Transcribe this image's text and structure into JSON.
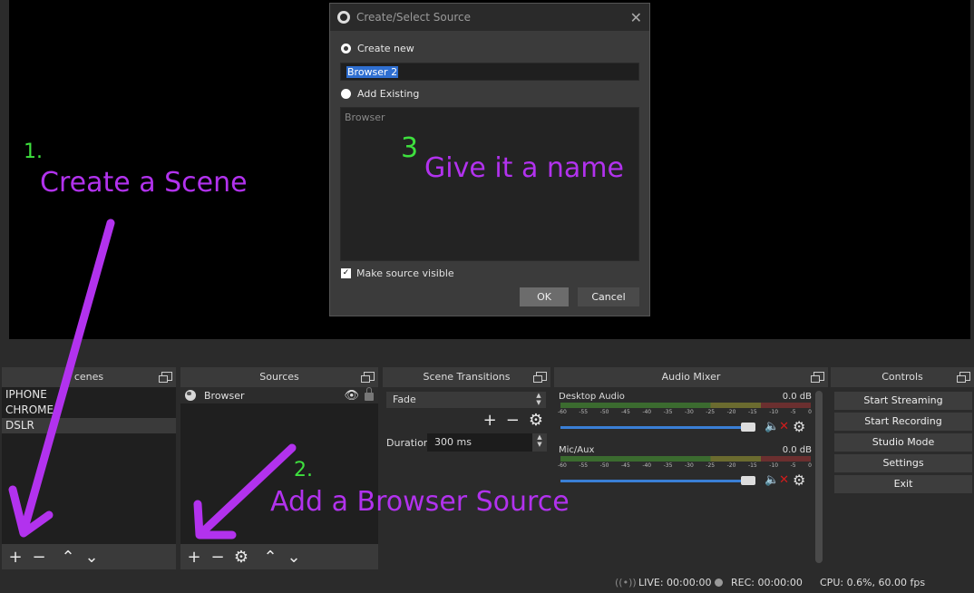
{
  "dialog": {
    "title": "Create/Select Source",
    "close_glyph": "✕",
    "create_new_label": "Create new",
    "name_value": "Browser 2",
    "add_existing_label": "Add Existing",
    "existing_items": [
      "Browser"
    ],
    "make_visible_label": "Make source visible",
    "ok_label": "OK",
    "cancel_label": "Cancel"
  },
  "docks": {
    "scenes": {
      "title": "cenes",
      "items": [
        "IPHONE",
        "CHROME",
        "DSLR"
      ],
      "selected_index": 2
    },
    "sources": {
      "title": "Sources",
      "items": [
        {
          "name": "Browser"
        }
      ]
    },
    "transitions": {
      "title": "Scene Transitions",
      "selected": "Fade",
      "duration_label": "Duration",
      "duration_value": "300 ms"
    },
    "mixer": {
      "title": "Audio Mixer",
      "channels": [
        {
          "name": "Desktop Audio",
          "db": "0.0 dB"
        },
        {
          "name": "Mic/Aux",
          "db": "0.0 dB"
        }
      ],
      "scale": [
        "-60",
        "-55",
        "-50",
        "-45",
        "-40",
        "-35",
        "-30",
        "-25",
        "-20",
        "-15",
        "-10",
        "-5",
        "0"
      ]
    },
    "controls": {
      "title": "Controls",
      "buttons": [
        "Start Streaming",
        "Start Recording",
        "Studio Mode",
        "Settings",
        "Exit"
      ]
    }
  },
  "status": {
    "live": "LIVE: 00:00:00",
    "rec": "REC: 00:00:00",
    "cpu": "CPU: 0.6%, 60.00 fps"
  },
  "annotations": {
    "step1_number": "1.",
    "step1_text": "Create a Scene",
    "step2_number": "2.",
    "step2_text": "Add a Browser Source",
    "step3_number": "3",
    "step3_text": "Give it a name"
  },
  "colors": {
    "annotation_purple": "#b232ee",
    "annotation_green": "#3ee03e",
    "accent_blue": "#3a7fd6",
    "mute_red": "#d21c1c"
  }
}
